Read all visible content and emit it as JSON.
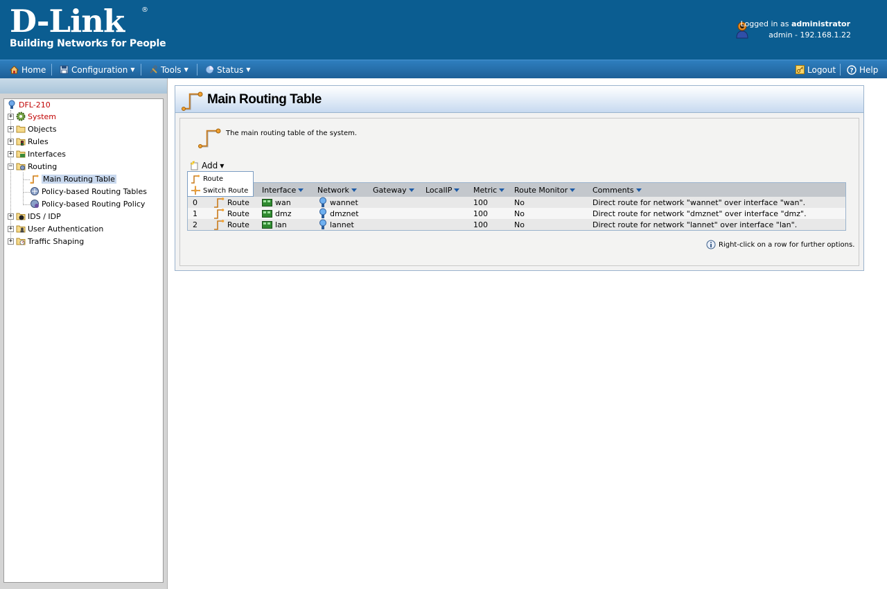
{
  "header": {
    "logo_title": "D-Link",
    "logo_reg": "®",
    "logo_tagline": "Building Networks for People",
    "logged_in_prefix": "Logged in as ",
    "logged_in_user": "administrator",
    "session_info": "admin - 192.168.1.22"
  },
  "menubar": {
    "home": "Home",
    "configuration": "Configuration",
    "tools": "Tools",
    "status": "Status",
    "logout": "Logout",
    "help": "Help"
  },
  "tree": {
    "root": "DFL-210",
    "system": "System",
    "objects": "Objects",
    "rules": "Rules",
    "interfaces": "Interfaces",
    "routing": "Routing",
    "main_routing_table": "Main Routing Table",
    "policy_routing_tables": "Policy-based Routing Tables",
    "policy_routing_policy": "Policy-based Routing Policy",
    "ids_idp": "IDS / IDP",
    "user_auth": "User Authentication",
    "traffic_shaping": "Traffic Shaping"
  },
  "main": {
    "title": "Main Routing Table",
    "description": "The main routing table of the system.",
    "add_label": "Add",
    "dropdown": [
      "Route",
      "Switch Route"
    ],
    "hint": "Right-click on a row for further options."
  },
  "table": {
    "columns": [
      "Interface",
      "Network",
      "Gateway",
      "LocalIP",
      "Metric",
      "Route Monitor",
      "Comments"
    ],
    "rows": [
      {
        "index": "0",
        "type": "Route",
        "interface": "wan",
        "network": "wannet",
        "gateway": "",
        "localip": "",
        "metric": "100",
        "monitor": "No",
        "comments": "Direct route for network \"wannet\" over interface \"wan\"."
      },
      {
        "index": "1",
        "type": "Route",
        "interface": "dmz",
        "network": "dmznet",
        "gateway": "",
        "localip": "",
        "metric": "100",
        "monitor": "No",
        "comments": "Direct route for network \"dmznet\" over interface \"dmz\"."
      },
      {
        "index": "2",
        "type": "Route",
        "interface": "lan",
        "network": "lannet",
        "gateway": "",
        "localip": "",
        "metric": "100",
        "monitor": "No",
        "comments": "Direct route for network \"lannet\" over interface \"lan\"."
      }
    ]
  }
}
